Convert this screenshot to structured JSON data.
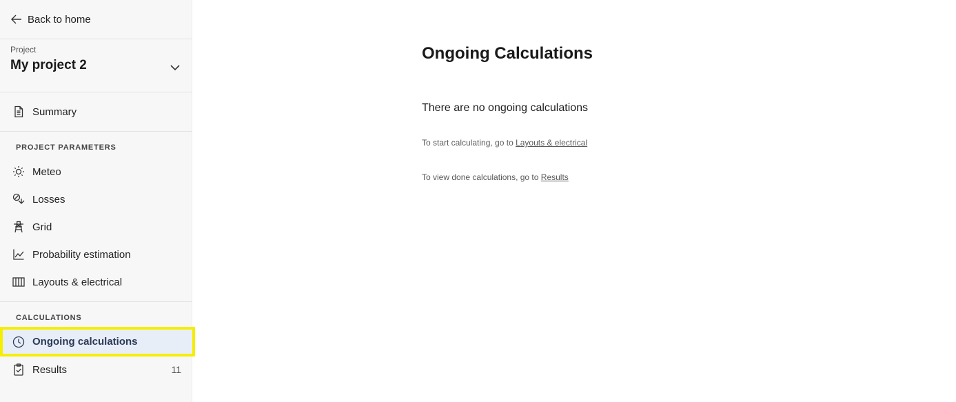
{
  "sidebar": {
    "back_label": "Back to home",
    "project_label": "Project",
    "project_name": "My project 2",
    "summary_label": "Summary",
    "section_params": "PROJECT PARAMETERS",
    "items_params": [
      {
        "label": "Meteo",
        "icon": "sun-icon"
      },
      {
        "label": "Losses",
        "icon": "losses-icon"
      },
      {
        "label": "Grid",
        "icon": "transmission-tower-icon"
      },
      {
        "label": "Probability estimation",
        "icon": "line-chart-icon"
      },
      {
        "label": "Layouts & electrical",
        "icon": "columns-icon"
      }
    ],
    "section_calcs": "CALCULATIONS",
    "ongoing_label": "Ongoing calculations",
    "results_label": "Results",
    "results_count": "11"
  },
  "main": {
    "title": "Ongoing Calculations",
    "empty_message": "There are no ongoing calculations",
    "start_prefix": "To start calculating, go to ",
    "start_link": "Layouts & electrical",
    "view_prefix": "To view done calculations, go to ",
    "view_link": "Results"
  }
}
